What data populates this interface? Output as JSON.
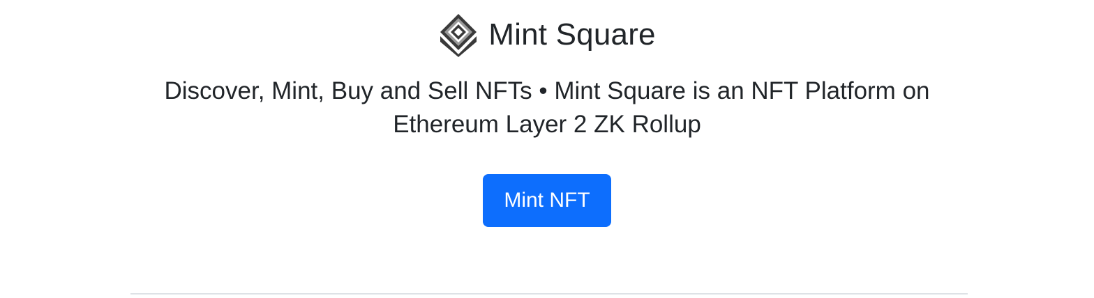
{
  "header": {
    "logo_icon": "mint-square-diamond-icon",
    "brand_name": "Mint Square"
  },
  "hero": {
    "tagline": "Discover, Mint, Buy and Sell NFTs • Mint Square is an NFT Platform on Ethereum Layer 2 ZK Rollup",
    "cta_label": "Mint NFT"
  },
  "colors": {
    "primary": "#0d6efd",
    "text": "#212529",
    "logo_dark": "#333333",
    "logo_light": "#8a8a8a",
    "divider": "#dee2e6"
  }
}
